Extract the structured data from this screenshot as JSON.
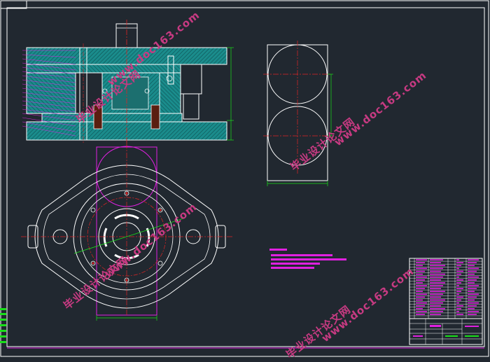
{
  "watermark": {
    "site": "www.doc163.com",
    "label": "毕业设计论文网"
  },
  "colors": {
    "background": "#212830",
    "frame": "#ffffff",
    "hatch_fill": "#1f9a9a",
    "outline": "#ffffff",
    "center_line": "#e02424",
    "dimension": "#19e019",
    "construction": "#e020e0",
    "watermark": "#c73a82",
    "title_block": "#ffffff"
  }
}
